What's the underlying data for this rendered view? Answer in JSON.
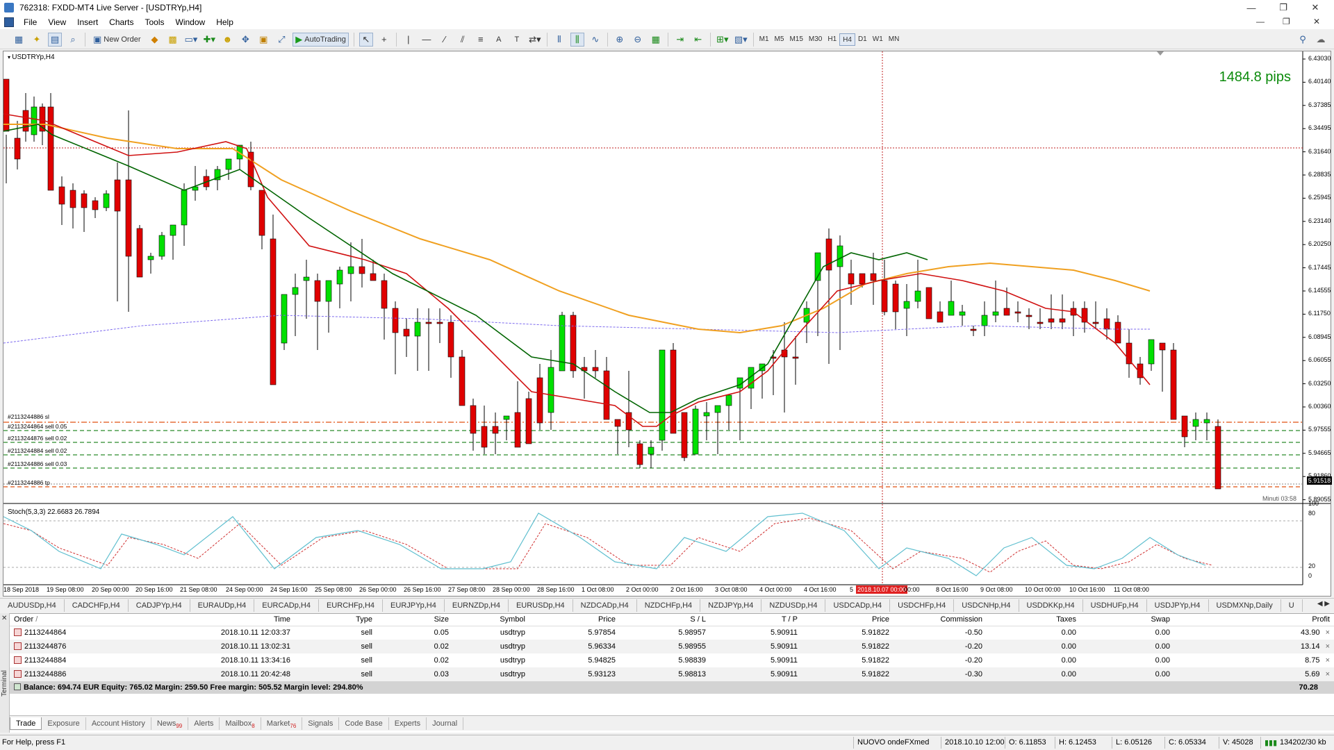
{
  "window": {
    "title": "762318: FXDD-MT4 Live Server - [USDTRYp,H4]",
    "controls": [
      "—",
      "❐",
      "✕"
    ],
    "mdi_controls": [
      "—",
      "❐",
      "✕"
    ]
  },
  "menu": [
    "File",
    "View",
    "Insert",
    "Charts",
    "Tools",
    "Window",
    "Help"
  ],
  "toolbar": {
    "new_order": "New Order",
    "autotrading": "AutoTrading",
    "text_tool": "A",
    "label_tool": "T",
    "timeframes": [
      "M1",
      "M5",
      "M15",
      "M30",
      "H1",
      "H4",
      "D1",
      "W1",
      "MN"
    ],
    "active_timeframe": "H4"
  },
  "chart": {
    "symbol_label": "USDTRYp,H4",
    "pips_label": "1484.8 pips",
    "indicator_label": "Stoch(5,3,3) 22.6683 26.7894",
    "timer": "Minuti 03:58",
    "current_price": "5.91518",
    "crosshair_time": "2018.10.07 00:00",
    "price_ticks": [
      "6.43030",
      "6.40140",
      "6.37385",
      "6.34495",
      "6.31640",
      "6.28835",
      "6.25945",
      "6.23140",
      "6.20250",
      "6.17445",
      "6.14555",
      "6.11750",
      "6.08945",
      "6.06055",
      "6.03250",
      "6.00360",
      "5.97555",
      "5.94665",
      "5.91860",
      "5.89055"
    ],
    "stoch_ticks": [
      "100",
      "80",
      "20",
      "0"
    ],
    "time_ticks": [
      "18 Sep 2018",
      "19 Sep 08:00",
      "20 Sep 00:00",
      "20 Sep 16:00",
      "21 Sep 08:00",
      "24 Sep 00:00",
      "24 Sep 16:00",
      "25 Sep 08:00",
      "26 Sep 00:00",
      "26 Sep 16:00",
      "27 Sep 08:00",
      "28 Sep 00:00",
      "28 Sep 16:00",
      "1 Oct 08:00",
      "2 Oct 00:00",
      "2 Oct 16:00",
      "3 Oct 08:00",
      "4 Oct 00:00",
      "4 Oct 16:00",
      "5",
      "8 Oct 16:00",
      "9 Oct 08:00",
      "10 Oct 00:00",
      "10 Oct 16:00",
      "11 Oct 08:00"
    ],
    "time_tick_partial": "00:00",
    "order_labels": [
      "#2113244886 sl",
      "#2113244864 sell 0.05",
      "#2113244876 sell 0.02",
      "#2113244884 sell 0.02",
      "#2113244886 sell 0.03",
      "#2113244886 tp"
    ],
    "colors": {
      "bull": "#00e000",
      "bear": "#e00000",
      "ma_fast": "#006400",
      "ma_mid": "#d01010",
      "ma_slow": "#f0a020",
      "ma_long": "#7b68ee",
      "stoch_main": "#5fbfcf",
      "stoch_signal": "#d03030"
    }
  },
  "symbol_tabs": [
    "AUDUSDp,H4",
    "CADCHFp,H4",
    "CADJPYp,H4",
    "EURAUDp,H4",
    "EURCADp,H4",
    "EURCHFp,H4",
    "EURJPYp,H4",
    "EURNZDp,H4",
    "EURUSDp,H4",
    "NZDCADp,H4",
    "NZDCHFp,H4",
    "NZDJPYp,H4",
    "NZDUSDp,H4",
    "USDCADp,H4",
    "USDCHFp,H4",
    "USDCNHp,H4",
    "USDDKKp,H4",
    "USDHUFp,H4",
    "USDJPYp,H4",
    "USDMXNp,Daily",
    "U"
  ],
  "terminal": {
    "side_label": "Terminal",
    "columns": [
      "Order",
      "/",
      "Time",
      "Type",
      "Size",
      "Symbol",
      "Price",
      "S / L",
      "T / P",
      "Price",
      "Commission",
      "Taxes",
      "Swap",
      "Profit"
    ],
    "rows": [
      {
        "order": "2113244864",
        "time": "2018.10.11 12:03:37",
        "type": "sell",
        "size": "0.05",
        "symbol": "usdtryp",
        "price": "5.97854",
        "sl": "5.98957",
        "tp": "5.90911",
        "cur": "5.91822",
        "commission": "-0.50",
        "taxes": "0.00",
        "swap": "0.00",
        "profit": "43.90"
      },
      {
        "order": "2113244876",
        "time": "2018.10.11 13:02:31",
        "type": "sell",
        "size": "0.02",
        "symbol": "usdtryp",
        "price": "5.96334",
        "sl": "5.98955",
        "tp": "5.90911",
        "cur": "5.91822",
        "commission": "-0.20",
        "taxes": "0.00",
        "swap": "0.00",
        "profit": "13.14"
      },
      {
        "order": "2113244884",
        "time": "2018.10.11 13:34:16",
        "type": "sell",
        "size": "0.02",
        "symbol": "usdtryp",
        "price": "5.94825",
        "sl": "5.98839",
        "tp": "5.90911",
        "cur": "5.91822",
        "commission": "-0.20",
        "taxes": "0.00",
        "swap": "0.00",
        "profit": "8.75"
      },
      {
        "order": "2113244886",
        "time": "2018.10.11 20:42:48",
        "type": "sell",
        "size": "0.03",
        "symbol": "usdtryp",
        "price": "5.93123",
        "sl": "5.98813",
        "tp": "5.90911",
        "cur": "5.91822",
        "commission": "-0.30",
        "taxes": "0.00",
        "swap": "0.00",
        "profit": "5.69"
      }
    ],
    "balance_line": "Balance: 694.74 EUR  Equity: 765.02  Margin: 259.50  Free margin: 505.52  Margin level: 294.80%",
    "balance_profit": "70.28",
    "close_glyph": "×",
    "tabs": [
      {
        "label": "Trade",
        "badge": ""
      },
      {
        "label": "Exposure",
        "badge": ""
      },
      {
        "label": "Account History",
        "badge": ""
      },
      {
        "label": "News",
        "badge": "99"
      },
      {
        "label": "Alerts",
        "badge": ""
      },
      {
        "label": "Mailbox",
        "badge": "8"
      },
      {
        "label": "Market",
        "badge": "76"
      },
      {
        "label": "Signals",
        "badge": ""
      },
      {
        "label": "Code Base",
        "badge": ""
      },
      {
        "label": "Experts",
        "badge": ""
      },
      {
        "label": "Journal",
        "badge": ""
      }
    ]
  },
  "statusbar": {
    "help": "For Help, press F1",
    "profile": "NUOVO ondeFXmed",
    "datetime": "2018.10.10 12:00",
    "open": "O: 6.11853",
    "high": "H: 6.12453",
    "low": "L: 6.05126",
    "close": "C: 6.05334",
    "volume": "V: 45028",
    "traffic": "134202/30 kb"
  }
}
